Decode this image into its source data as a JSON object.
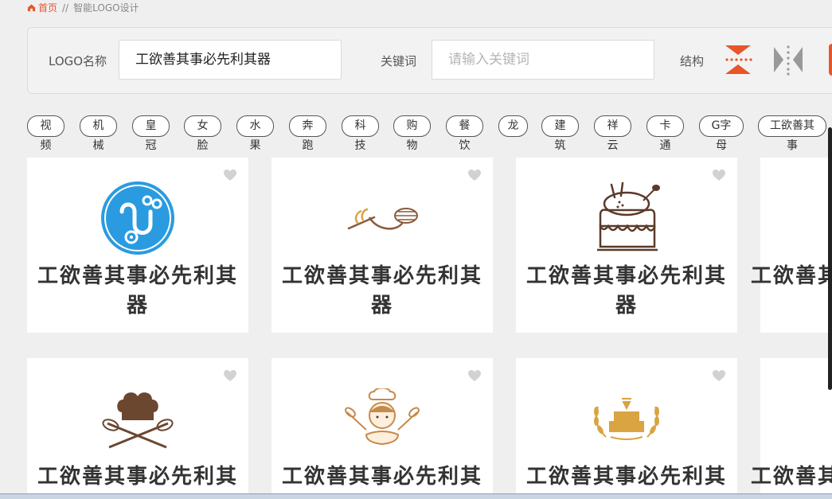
{
  "breadcrumb": {
    "home": "首页",
    "separator": "//",
    "current": "智能LOGO设计"
  },
  "search": {
    "name_label": "LOGO名称",
    "name_value": "工欲善其事必先利其器",
    "keyword_label": "关键词",
    "keyword_placeholder": "请输入关键词",
    "structure_label": "结构"
  },
  "structure_icons": [
    "top-bottom-layout-icon",
    "left-right-layout-icon",
    "layout-option-icon"
  ],
  "tags": [
    {
      "pill": "视",
      "rest": "频"
    },
    {
      "pill": "机",
      "rest": "械"
    },
    {
      "pill": "皇",
      "rest": "冠"
    },
    {
      "pill": "女",
      "rest": "脸"
    },
    {
      "pill": "水",
      "rest": "果"
    },
    {
      "pill": "奔",
      "rest": "跑"
    },
    {
      "pill": "科",
      "rest": "技"
    },
    {
      "pill": "购",
      "rest": "物"
    },
    {
      "pill": "餐",
      "rest": "饮"
    },
    {
      "pill": "龙",
      "rest": ""
    },
    {
      "pill": "建",
      "rest": "筑"
    },
    {
      "pill": "祥",
      "rest": "云"
    },
    {
      "pill": "卡",
      "rest": "通"
    },
    {
      "pill": "G字",
      "rest": "母"
    },
    {
      "pill": "工欲善其",
      "rest": "事"
    }
  ],
  "cards": [
    {
      "title": "工欲善其事必先利其器",
      "icon": "stethoscope-icon"
    },
    {
      "title": "工欲善其事必先利其器",
      "icon": "wheat-whisk-icon"
    },
    {
      "title": "工欲善其事必先利其器",
      "icon": "bunny-cake-icon"
    },
    {
      "title": "工欲善其",
      "icon": ""
    },
    {
      "title": "工欲善其事必先利其器",
      "icon": "chef-hat-whisks-icon"
    },
    {
      "title": "工欲善其事必先利其器",
      "icon": "chef-girl-icon"
    },
    {
      "title": "工欲善其事必先利其器",
      "icon": "cake-wreath-icon"
    },
    {
      "title": "工欲善其",
      "icon": ""
    }
  ],
  "colors": {
    "accent": "#e8552b",
    "blue": "#2a9be0",
    "brown": "#8a5a3b",
    "gold": "#d9a441"
  }
}
